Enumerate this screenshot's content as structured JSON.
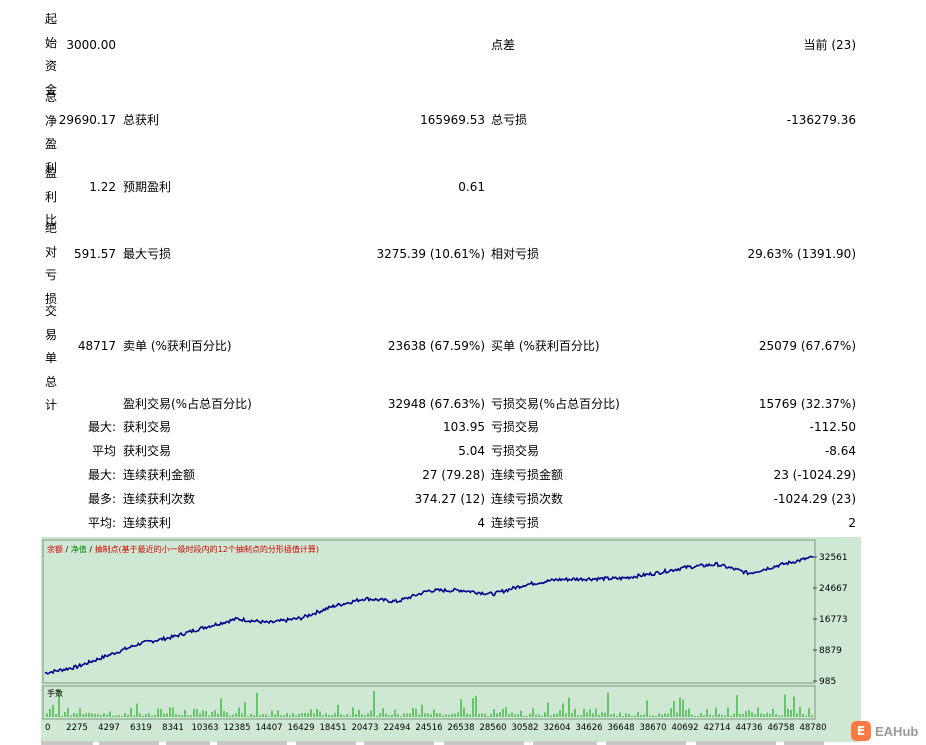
{
  "summary": {
    "initial_deposit": {
      "label_chars": [
        "起",
        "始",
        "资",
        "金"
      ],
      "value": "3000.00"
    },
    "spread": {
      "label": "点差",
      "value": "当前 (23)"
    },
    "net_profit": {
      "label_chars": [
        "总",
        "净",
        "盈",
        "利"
      ],
      "value": "29690.17"
    },
    "gross_profit": {
      "label": "总获利",
      "value": "165969.53"
    },
    "gross_loss": {
      "label": "总亏损",
      "value": "-136279.36"
    },
    "profit_factor": {
      "label_chars": [
        "盈",
        "利",
        "比"
      ],
      "value": "1.22"
    },
    "expected_payoff": {
      "label": "预期盈利",
      "value": "0.61"
    },
    "absolute_drawdown": {
      "label_chars": [
        "绝",
        "对",
        "亏",
        "损"
      ],
      "value": "591.57"
    },
    "maximal_drawdown": {
      "label": "最大亏损",
      "value": "3275.39 (10.61%)"
    },
    "relative_drawdown": {
      "label": "相对亏损",
      "value": "29.63% (1391.90)"
    },
    "total_trades": {
      "label_chars": [
        "交",
        "易",
        "单",
        "总",
        "计"
      ],
      "value": "48717"
    },
    "short_positions": {
      "label": "卖单 (%获利百分比)",
      "value": "23638 (67.59%)"
    },
    "long_positions": {
      "label": "买单 (%获利百分比)",
      "value": "25079 (67.67%)"
    },
    "profit_trades": {
      "label": "盈利交易(%占总百分比)",
      "value": "32948 (67.63%)"
    },
    "loss_trades": {
      "label": "亏损交易(%占总百分比)",
      "value": "15769 (32.37%)"
    },
    "largest": {
      "prefix": "最大:",
      "profit_label": "获利交易",
      "profit_value": "103.95",
      "loss_label": "亏损交易",
      "loss_value": "-112.50"
    },
    "average": {
      "prefix": "平均",
      "profit_label": "获利交易",
      "profit_value": "5.04",
      "loss_label": "亏损交易",
      "loss_value": "-8.64"
    },
    "max_consecutive": {
      "prefix": "最大:",
      "profit_label": "连续获利金额",
      "profit_value": "27 (79.28)",
      "loss_label": "连续亏损金额",
      "loss_value": "23 (-1024.29)"
    },
    "max_consecutive_amount": {
      "prefix": "最多:",
      "profit_label": "连续获利次数",
      "profit_value": "374.27 (12)",
      "loss_label": "连续亏损次数",
      "loss_value": "-1024.29 (23)"
    },
    "avg_consecutive": {
      "prefix": "平均:",
      "profit_label": "连续获利",
      "profit_value": "4",
      "loss_label": "连续亏损",
      "loss_value": "2"
    }
  },
  "chart_data": {
    "type": "line",
    "legend": {
      "balance": "余额",
      "sep1": " / ",
      "equity": "净值",
      "sep2": " / ",
      "ticks": "抽制点(基于最近的小一级时段内的12个抽制点的分形插值计算)"
    },
    "y_ticks": [
      "32561",
      "24667",
      "16773",
      "8879",
      "985"
    ],
    "ylim": [
      985,
      32561
    ],
    "x_ticks": [
      "0",
      "2275",
      "4297",
      "6319",
      "8341",
      "10363",
      "12385",
      "14407",
      "16429",
      "18451",
      "20473",
      "22494",
      "24516",
      "26538",
      "28560",
      "30582",
      "32604",
      "34626",
      "36648",
      "38670",
      "40692",
      "42714",
      "44736",
      "46758",
      "48780"
    ],
    "volume_label": "手数",
    "series": [
      {
        "name": "余额",
        "color": "#00008b",
        "x": [
          0,
          2275,
          4297,
          6319,
          8341,
          10363,
          12385,
          14407,
          16429,
          18451,
          20473,
          22494,
          24516,
          26538,
          28560,
          30582,
          32604,
          34626,
          36648,
          38670,
          40692,
          42714,
          44736,
          46758,
          48780
        ],
        "values": [
          3000,
          4600,
          7600,
          10600,
          12200,
          14700,
          16800,
          15800,
          17000,
          20000,
          22000,
          21200,
          24000,
          24100,
          23100,
          25500,
          26800,
          27000,
          27100,
          28300,
          29900,
          30700,
          28400,
          30600,
          32500
        ]
      }
    ],
    "colors": {
      "balance": "#00008b",
      "legend_red": "#d00000",
      "legend_green": "#008000",
      "volume": "#00a000",
      "bg": "#cfe8d4",
      "plot_bg": "#ffffff"
    }
  },
  "watermark": {
    "text": "EAHub",
    "badge": "E"
  }
}
